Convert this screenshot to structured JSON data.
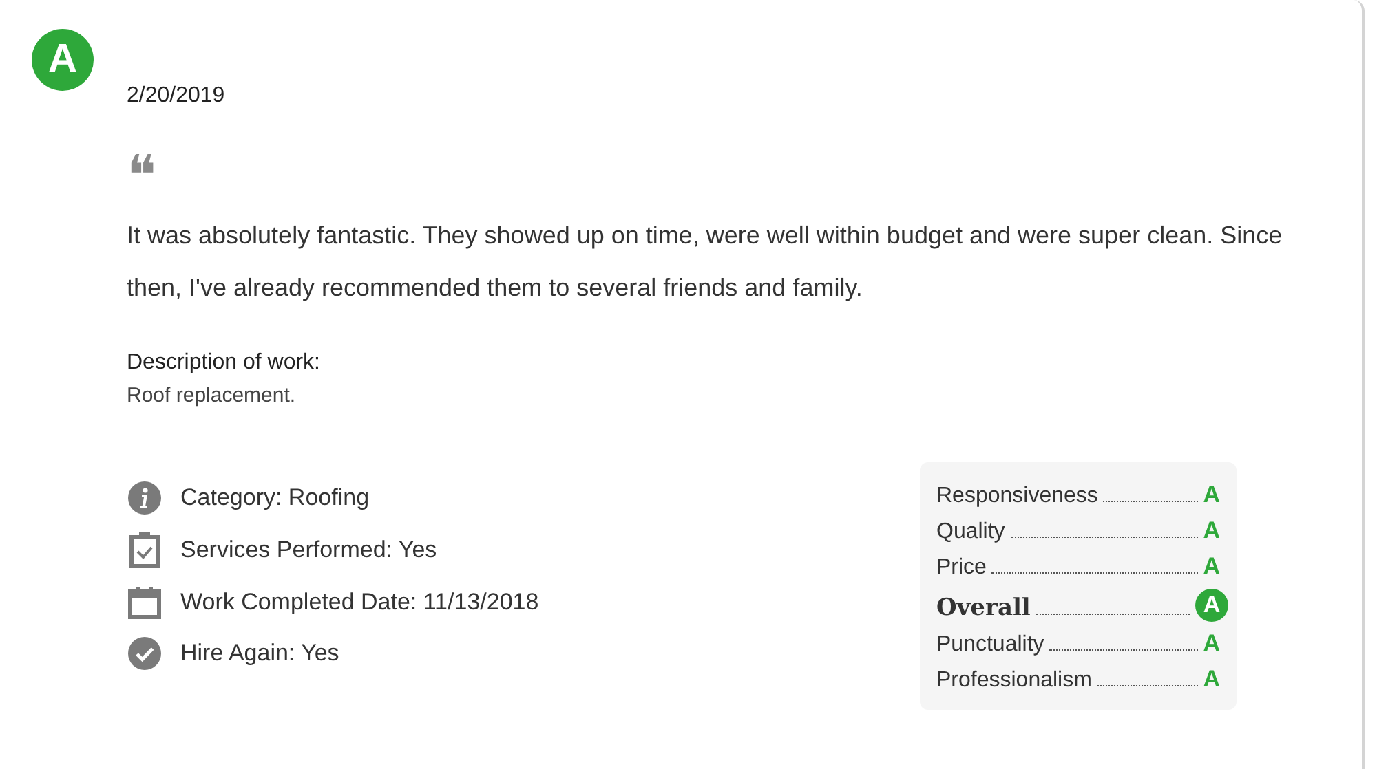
{
  "review": {
    "grade": "A",
    "date": "2/20/2019",
    "quote_mark": "❝",
    "text": "It was absolutely fantastic. They showed up on time, were well within budget and were super clean. Since then, I've already recommended them to several friends and family.",
    "description_label": "Description of work:",
    "description": "Roof replacement."
  },
  "details": [
    {
      "kind": "info",
      "text": "Category: Roofing"
    },
    {
      "kind": "clipboard",
      "text": "Services Performed: Yes"
    },
    {
      "kind": "calendar",
      "text": "Work Completed Date: 11/13/2018"
    },
    {
      "kind": "check",
      "text": "Hire Again: Yes"
    }
  ],
  "ratings": [
    {
      "kind": "normal",
      "label": "Responsiveness",
      "grade": "A"
    },
    {
      "kind": "normal",
      "label": "Quality",
      "grade": "A"
    },
    {
      "kind": "normal",
      "label": "Price",
      "grade": "A"
    },
    {
      "kind": "overall",
      "label": "Overall",
      "grade": "A"
    },
    {
      "kind": "normal",
      "label": "Punctuality",
      "grade": "A"
    },
    {
      "kind": "normal",
      "label": "Professionalism",
      "grade": "A"
    }
  ]
}
